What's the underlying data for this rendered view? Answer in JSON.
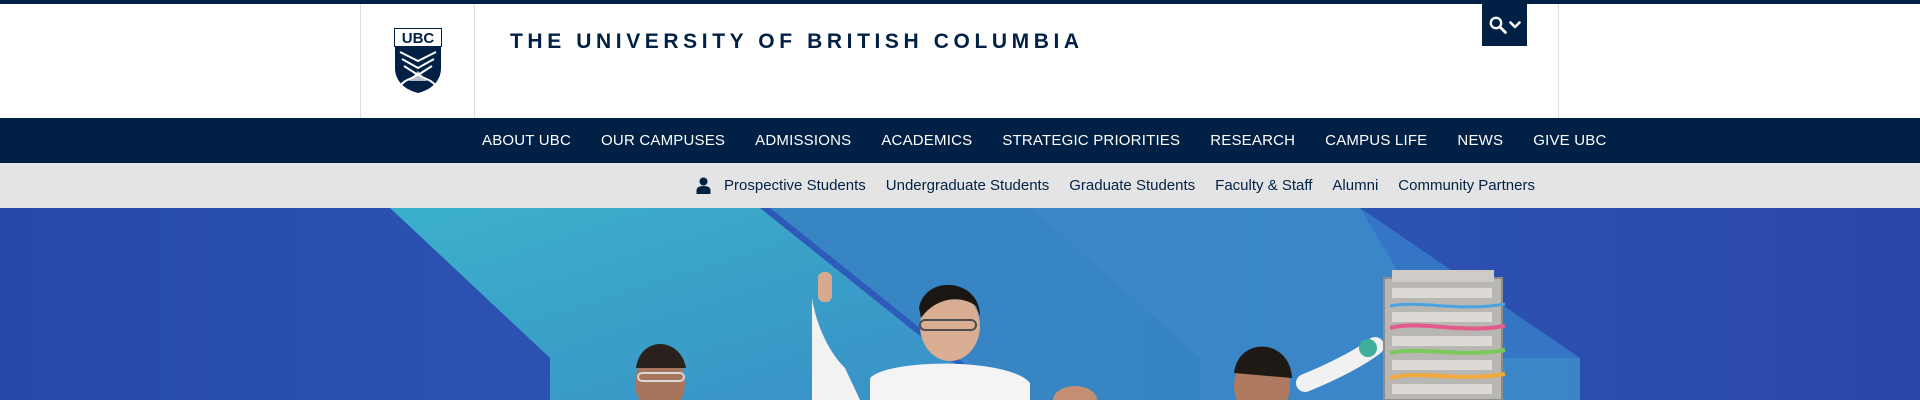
{
  "header": {
    "logo_text": "UBC",
    "site_title": "THE UNIVERSITY OF BRITISH COLUMBIA",
    "search_icon": "search-icon",
    "chevron_icon": "chevron-down-icon"
  },
  "primary_nav": {
    "items": [
      {
        "label": "ABOUT UBC"
      },
      {
        "label": "OUR CAMPUSES"
      },
      {
        "label": "ADMISSIONS"
      },
      {
        "label": "ACADEMICS"
      },
      {
        "label": "STRATEGIC PRIORITIES"
      },
      {
        "label": "RESEARCH"
      },
      {
        "label": "CAMPUS LIFE"
      },
      {
        "label": "NEWS"
      },
      {
        "label": "GIVE UBC"
      }
    ]
  },
  "audience_nav": {
    "icon": "person-icon",
    "items": [
      {
        "label": "Prospective Students"
      },
      {
        "label": "Undergraduate Students"
      },
      {
        "label": "Graduate Students"
      },
      {
        "label": "Faculty & Staff"
      },
      {
        "label": "Alumni"
      },
      {
        "label": "Community Partners"
      }
    ]
  },
  "colors": {
    "brand_navy": "#002145",
    "audience_bar": "#e4e4e4",
    "hero_blue": "#2d4fb0",
    "hero_teal": "#3fa5c8"
  }
}
